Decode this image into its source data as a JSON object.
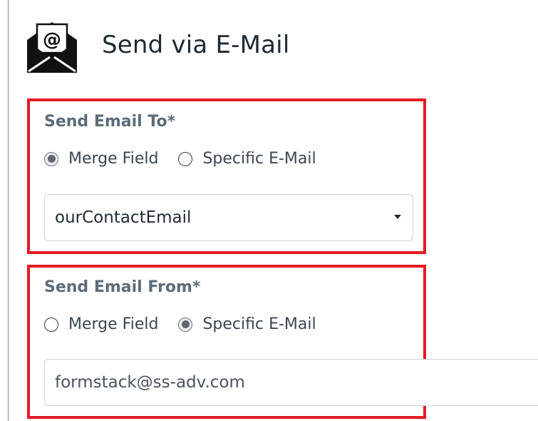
{
  "header": {
    "title": "Send via E-Mail",
    "icon": "email-envelope-icon",
    "icon_glyph": "@"
  },
  "send_to": {
    "label": "Send Email To*",
    "options": [
      {
        "label": "Merge Field",
        "checked": true
      },
      {
        "label": "Specific E-Mail",
        "checked": false
      }
    ],
    "selected_value": "ourContactEmail"
  },
  "send_from": {
    "label": "Send Email From*",
    "options": [
      {
        "label": "Merge Field",
        "checked": false
      },
      {
        "label": "Specific E-Mail",
        "checked": true
      }
    ],
    "input_value": "formstack@ss-adv.com"
  },
  "colors": {
    "highlight_border": "#e41b23",
    "label_text": "#5d6b78",
    "title_text": "#1e2a34"
  }
}
